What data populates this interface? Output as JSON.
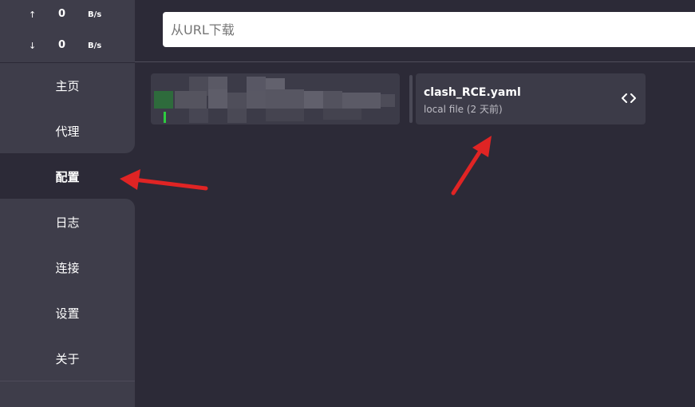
{
  "speed": {
    "up": {
      "arrow": "↑",
      "value": "0",
      "unit": "B/s"
    },
    "down": {
      "arrow": "↓",
      "value": "0",
      "unit": "B/s"
    }
  },
  "nav": {
    "items": [
      {
        "label": "主页"
      },
      {
        "label": "代理"
      },
      {
        "label": "配置",
        "active": true
      },
      {
        "label": "日志"
      },
      {
        "label": "连接"
      },
      {
        "label": "设置"
      },
      {
        "label": "关于"
      }
    ]
  },
  "download": {
    "placeholder": "从URL下载"
  },
  "profiles": [
    {
      "name": "",
      "detail": "",
      "obscured": true
    },
    {
      "name": "clash_RCE.yaml",
      "detail": "local file (2 天前)",
      "icon": "code-icon"
    }
  ],
  "colors": {
    "background": "#2c2a37",
    "panel": "#3e3d4a",
    "card": "#3c3b48",
    "annotation_arrow": "#e02424"
  }
}
